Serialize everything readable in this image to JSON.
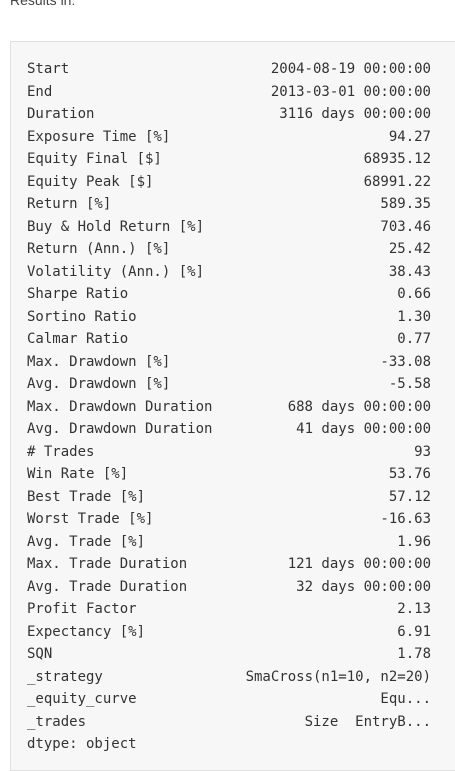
{
  "header": {
    "label": "Results in:"
  },
  "stats": [
    {
      "key": "Start",
      "value": "2004-08-19 00:00:00"
    },
    {
      "key": "End",
      "value": "2013-03-01 00:00:00"
    },
    {
      "key": "Duration",
      "value": "3116 days 00:00:00"
    },
    {
      "key": "Exposure Time [%]",
      "value": "94.27"
    },
    {
      "key": "Equity Final [$]",
      "value": "68935.12"
    },
    {
      "key": "Equity Peak [$]",
      "value": "68991.22"
    },
    {
      "key": "Return [%]",
      "value": "589.35"
    },
    {
      "key": "Buy & Hold Return [%]",
      "value": "703.46"
    },
    {
      "key": "Return (Ann.) [%]",
      "value": "25.42"
    },
    {
      "key": "Volatility (Ann.) [%]",
      "value": "38.43"
    },
    {
      "key": "Sharpe Ratio",
      "value": "0.66"
    },
    {
      "key": "Sortino Ratio",
      "value": "1.30"
    },
    {
      "key": "Calmar Ratio",
      "value": "0.77"
    },
    {
      "key": "Max. Drawdown [%]",
      "value": "-33.08"
    },
    {
      "key": "Avg. Drawdown [%]",
      "value": "-5.58"
    },
    {
      "key": "Max. Drawdown Duration",
      "value": "688 days 00:00:00"
    },
    {
      "key": "Avg. Drawdown Duration",
      "value": "41 days 00:00:00"
    },
    {
      "key": "# Trades",
      "value": "93"
    },
    {
      "key": "Win Rate [%]",
      "value": "53.76"
    },
    {
      "key": "Best Trade [%]",
      "value": "57.12"
    },
    {
      "key": "Worst Trade [%]",
      "value": "-16.63"
    },
    {
      "key": "Avg. Trade [%]",
      "value": "1.96"
    },
    {
      "key": "Max. Trade Duration",
      "value": "121 days 00:00:00"
    },
    {
      "key": "Avg. Trade Duration",
      "value": "32 days 00:00:00"
    },
    {
      "key": "Profit Factor",
      "value": "2.13"
    },
    {
      "key": "Expectancy [%]",
      "value": "6.91"
    },
    {
      "key": "SQN",
      "value": "1.78"
    },
    {
      "key": "_strategy",
      "value": "SmaCross(n1=10, n2=20)"
    },
    {
      "key": "_equity_curve",
      "value": "Equ..."
    },
    {
      "key": "_trades",
      "value": "Size  EntryB..."
    }
  ],
  "footer": {
    "dtype": "dtype: object"
  }
}
